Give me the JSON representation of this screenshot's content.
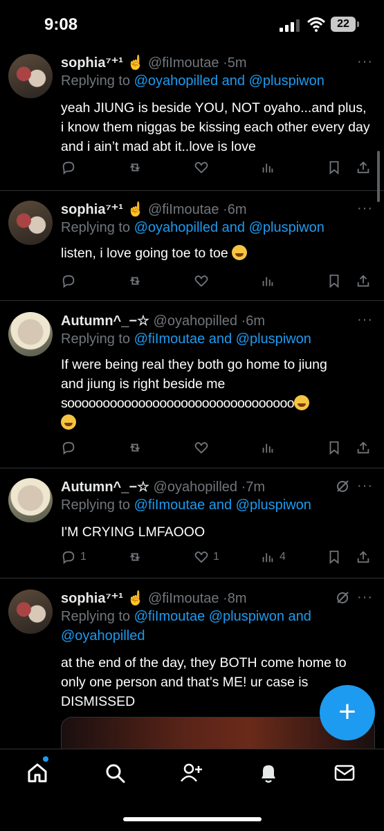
{
  "status_bar": {
    "time": "9:08",
    "battery": "22"
  },
  "tweets": [
    {
      "name": "sophia⁷⁺¹",
      "badge_icon": "hand-emoji",
      "handle": "@fiImoutae",
      "time": "5m",
      "reply_prefix": "Replying to ",
      "reply_to": "@oyahopilled and @pluspiwon",
      "text": "yeah JIUNG is beside YOU, NOT oyaho...and plus, i know them niggas be kissing each other every day and i ain’t mad abt it..love is love",
      "counts": {
        "reply": "",
        "retweet": "",
        "like": "",
        "views": ""
      }
    },
    {
      "name": "sophia⁷⁺¹",
      "badge_icon": "hand-emoji",
      "handle": "@fiImoutae",
      "time": "6m",
      "reply_prefix": "Replying to ",
      "reply_to": "@oyahopilled and @pluspiwon",
      "text": "listen, i love going toe to toe",
      "emoji": "pensive-face",
      "counts": {
        "reply": "",
        "retweet": "",
        "like": "",
        "views": ""
      }
    },
    {
      "name": "Autumn^_−☆",
      "handle": "@oyahopilled",
      "time": "6m",
      "reply_prefix": "Replying to ",
      "reply_to": "@fiImoutae and @pluspiwon",
      "text_line1": "If were being real they both go home to jiung",
      "text_line2": "and jiung is right beside me",
      "text_line3": "soooooooooooooooooooooooooooooooo",
      "emoji": "laughing-face",
      "counts": {
        "reply": "",
        "retweet": "",
        "like": "",
        "views": ""
      }
    },
    {
      "name": "Autumn^_−☆",
      "handle": "@oyahopilled",
      "time": "7m",
      "reply_prefix": "Replying to ",
      "reply_to": "@fiImoutae and @pluspiwon",
      "text": "I'M CRYING LMFAOOO",
      "counts": {
        "reply": "1",
        "retweet": "",
        "like": "1",
        "views": "4"
      }
    },
    {
      "name": "sophia⁷⁺¹",
      "badge_icon": "hand-emoji",
      "handle": "@fiImoutae",
      "time": "8m",
      "reply_prefix": "Replying to ",
      "reply_to_line1": "@fiImoutae @pluspiwon and",
      "reply_to_line2": "@oyahopilled",
      "text": "at the end of the day, they BOTH come home to only one person and that’s ME! ur case is DISMISSED"
    }
  ],
  "more_label": "···",
  "separator": "·",
  "fab_label": "+",
  "colors": {
    "accent": "#1d9bf0",
    "muted": "#71767b",
    "background": "#000000"
  }
}
